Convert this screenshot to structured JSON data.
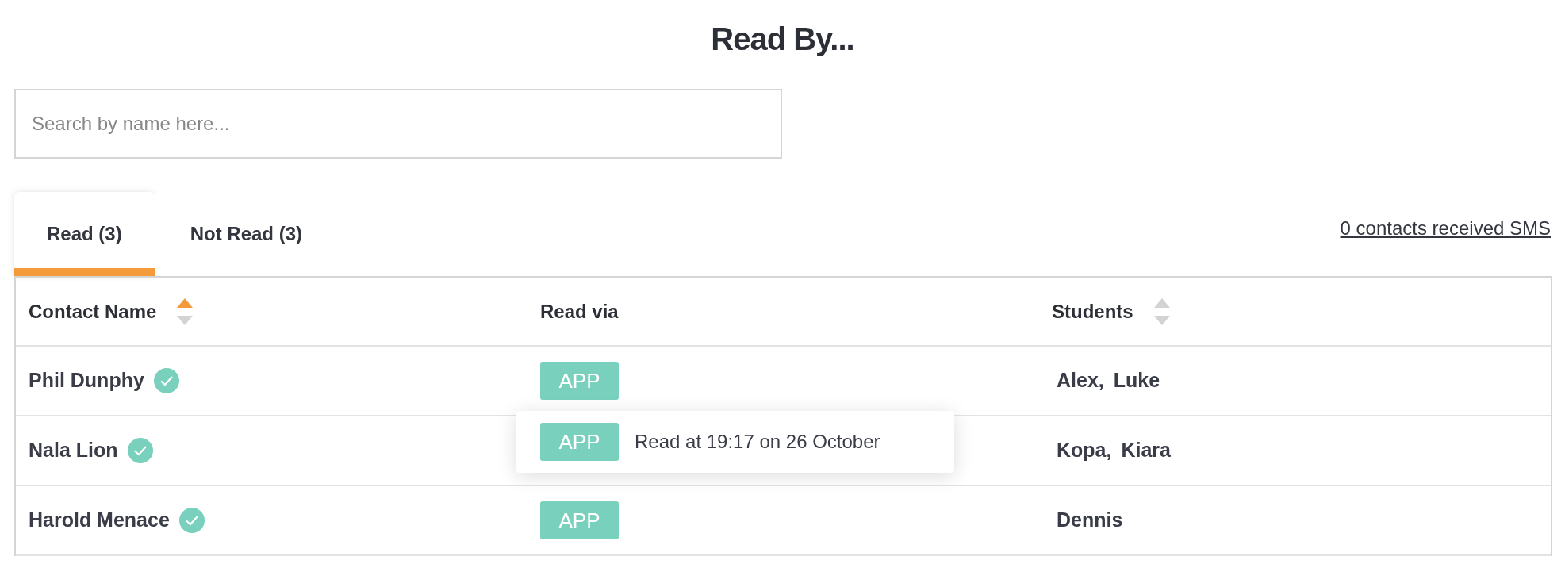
{
  "title": "Read By...",
  "search": {
    "placeholder": "Search by name here..."
  },
  "tabs": [
    {
      "label": "Read (3)",
      "selected": true
    },
    {
      "label": "Not Read (3)",
      "selected": false
    }
  ],
  "sms_link": "0 contacts received SMS",
  "table": {
    "columns": [
      {
        "label": "Contact Name",
        "sortable": true,
        "sorted": true
      },
      {
        "label": "Read via",
        "sortable": false
      },
      {
        "label": "Students",
        "sortable": true,
        "sorted": false
      }
    ],
    "rows": [
      {
        "name": "Phil Dunphy",
        "verified": true,
        "read_via": "APP",
        "students": [
          "Alex,",
          "Luke"
        ]
      },
      {
        "name": "Nala Lion",
        "verified": true,
        "students": [
          "Kopa,",
          "Kiara"
        ]
      },
      {
        "name": "Harold Menace",
        "verified": true,
        "read_via": "APP",
        "students": [
          "Dennis"
        ]
      }
    ]
  },
  "tooltip": {
    "badge": "APP",
    "text": "Read at 19:17 on 26 October"
  }
}
